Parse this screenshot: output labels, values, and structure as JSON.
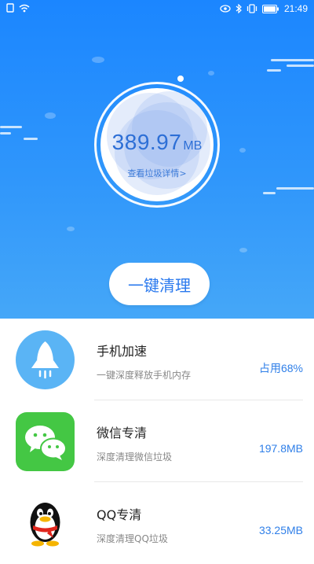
{
  "status_bar": {
    "time": "21:49",
    "left_icons": [
      "notification-icon",
      "wifi-icon"
    ],
    "right_icons": [
      "eye-icon",
      "bluetooth-icon",
      "vibrate-icon",
      "battery-icon"
    ]
  },
  "hero": {
    "junk_size": "389.97",
    "junk_unit": "MB",
    "detail_link": "查看垃圾详情>",
    "clean_button": "一键清理"
  },
  "items": [
    {
      "title": "手机加速",
      "subtitle": "一键深度释放手机内存",
      "value": "占用68%",
      "icon": "rocket-icon",
      "color": "#5ab4f5"
    },
    {
      "title": "微信专清",
      "subtitle": "深度清理微信垃圾",
      "value": "197.8MB",
      "icon": "wechat-icon",
      "color": "#44c744"
    },
    {
      "title": "QQ专清",
      "subtitle": "深度清理QQ垃圾",
      "value": "33.25MB",
      "icon": "qq-penguin-icon",
      "color": "#ffffff"
    }
  ]
}
